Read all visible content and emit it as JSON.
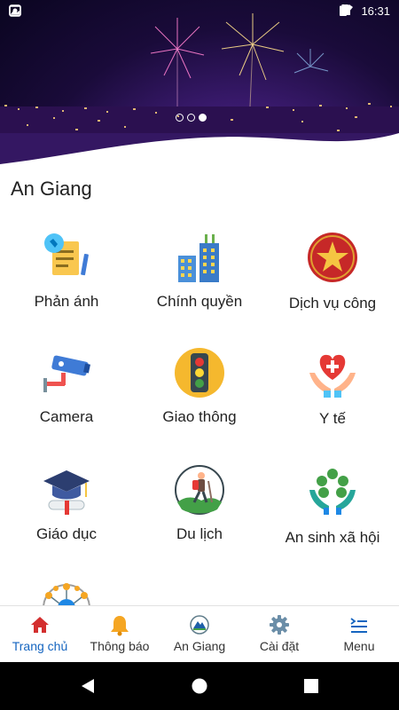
{
  "status_bar": {
    "time": "16:31"
  },
  "banner": {
    "slide_count": 3,
    "active_slide": 3
  },
  "region": {
    "title": "An Giang"
  },
  "services": [
    {
      "label": "Phản ánh",
      "icon": "report-icon"
    },
    {
      "label": "Chính quyền",
      "icon": "government-building-icon"
    },
    {
      "label": "Dịch vụ công",
      "icon": "public-service-emblem-icon"
    },
    {
      "label": "Camera",
      "icon": "security-camera-icon"
    },
    {
      "label": "Giao thông",
      "icon": "traffic-light-icon"
    },
    {
      "label": "Y tế",
      "icon": "health-care-icon"
    },
    {
      "label": "Giáo dục",
      "icon": "graduation-cap-icon"
    },
    {
      "label": "Du lịch",
      "icon": "hiker-icon"
    },
    {
      "label": "An sinh xã hội",
      "icon": "social-security-icon"
    },
    {
      "label": "",
      "icon": "network-globe-icon"
    }
  ],
  "bottom_nav": [
    {
      "label": "Trang chủ",
      "icon": "home-icon",
      "active": true
    },
    {
      "label": "Thông báo",
      "icon": "bell-icon",
      "active": false
    },
    {
      "label": "An Giang",
      "icon": "an-giang-logo-icon",
      "active": false
    },
    {
      "label": "Cài đặt",
      "icon": "gear-icon",
      "active": false
    },
    {
      "label": "Menu",
      "icon": "menu-icon",
      "active": false
    }
  ],
  "colors": {
    "accent": "#1565c0",
    "home": "#d32f2f",
    "bell": "#f5a623"
  }
}
